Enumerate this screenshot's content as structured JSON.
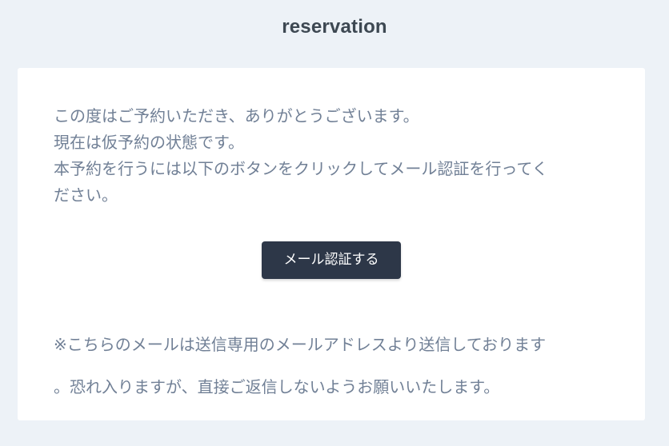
{
  "header": {
    "title": "reservation"
  },
  "body": {
    "lines": [
      "この度はご予約いただき、ありがとうございます。",
      "現在は仮予約の状態です。",
      "本予約を行うには以下のボタンをクリックしてメール認証を行ってく",
      "ださい。"
    ],
    "button_label": "メール認証する",
    "note_lines": [
      "※こちらのメールは送信専用のメールアドレスより送信しております",
      "。恐れ入りますが、直接ご返信しないようお願いいたします。"
    ]
  },
  "colors": {
    "page_background": "#edf2f7",
    "card_background": "#ffffff",
    "title_text": "#3d4852",
    "body_text": "#718096",
    "button_background": "#2d3748",
    "button_text": "#ffffff"
  }
}
